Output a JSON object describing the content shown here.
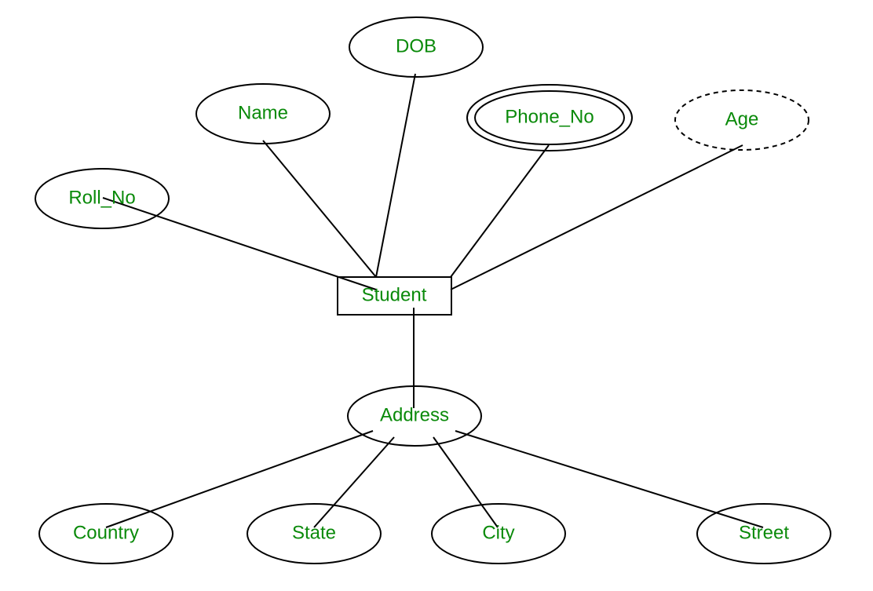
{
  "entity": {
    "label": "Student"
  },
  "attributes": {
    "roll_no": {
      "label": "Roll_No"
    },
    "name": {
      "label": "Name"
    },
    "dob": {
      "label": "DOB"
    },
    "phone_no": {
      "label": "Phone_No"
    },
    "age": {
      "label": "Age"
    },
    "address": {
      "label": "Address"
    }
  },
  "sub_attributes": {
    "country": {
      "label": "Country"
    },
    "state": {
      "label": "State"
    },
    "city": {
      "label": "City"
    },
    "street": {
      "label": "Street"
    }
  }
}
